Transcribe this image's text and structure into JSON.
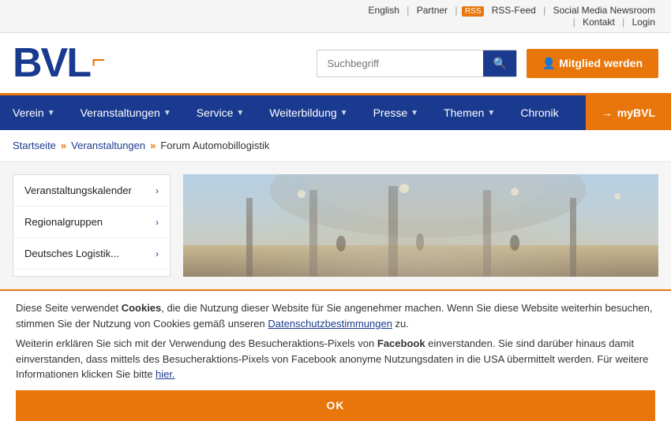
{
  "topbar": {
    "links": [
      "English",
      "Partner",
      "RSS-Feed",
      "Social Media Newsroom",
      "Kontakt",
      "Login"
    ],
    "separators": [
      "|",
      "|",
      "|",
      "|",
      "|"
    ]
  },
  "header": {
    "logo": "BVL",
    "logo_accent": "▐",
    "search_placeholder": "Suchbegriff",
    "search_icon": "🔍",
    "mitglied_label": "Mitglied werden",
    "user_icon": "👤"
  },
  "nav": {
    "items": [
      {
        "label": "Verein",
        "has_dropdown": true
      },
      {
        "label": "Veranstaltungen",
        "has_dropdown": true
      },
      {
        "label": "Service",
        "has_dropdown": true
      },
      {
        "label": "Weiterbildung",
        "has_dropdown": true
      },
      {
        "label": "Presse",
        "has_dropdown": true
      },
      {
        "label": "Themen",
        "has_dropdown": true
      },
      {
        "label": "Chronik",
        "has_dropdown": false
      }
    ],
    "mybvl_label": "myBVL"
  },
  "breadcrumb": {
    "items": [
      "Startseite",
      "Veranstaltungen",
      "Forum Automobillogistik"
    ]
  },
  "sidebar": {
    "items": [
      {
        "label": "Veranstaltungskalender",
        "has_arrow": true
      },
      {
        "label": "Regionalgruppen",
        "has_arrow": true
      },
      {
        "label": "Deutsches Logistik...",
        "has_arrow": true
      }
    ]
  },
  "cookie": {
    "text1": "Diese Seite verwendet ",
    "cookies_bold": "Cookies",
    "text2": ", die die Nutzung dieser Website für Sie angenehmer machen. Wenn Sie diese Website weiterhin besuchen, stimmen Sie der Nutzung von Cookies gemäß unseren ",
    "datenschutz_link": "Datenschutzbestimmungen",
    "text3": " zu.",
    "text4": "Weiterin erklären Sie sich mit der Verwendung des Besucheraktions-Pixels von ",
    "facebook_bold": "Facebook",
    "text5": " einverstanden. Sie sind darüber hinaus damit einverstanden, dass mittels des Besucheraktions-Pixels von Facebook anonyme Nutzungsdaten in die USA übermittelt werden. Für weitere Informationen klicken Sie bitte ",
    "hier_link": "hier.",
    "ok_label": "OK"
  }
}
